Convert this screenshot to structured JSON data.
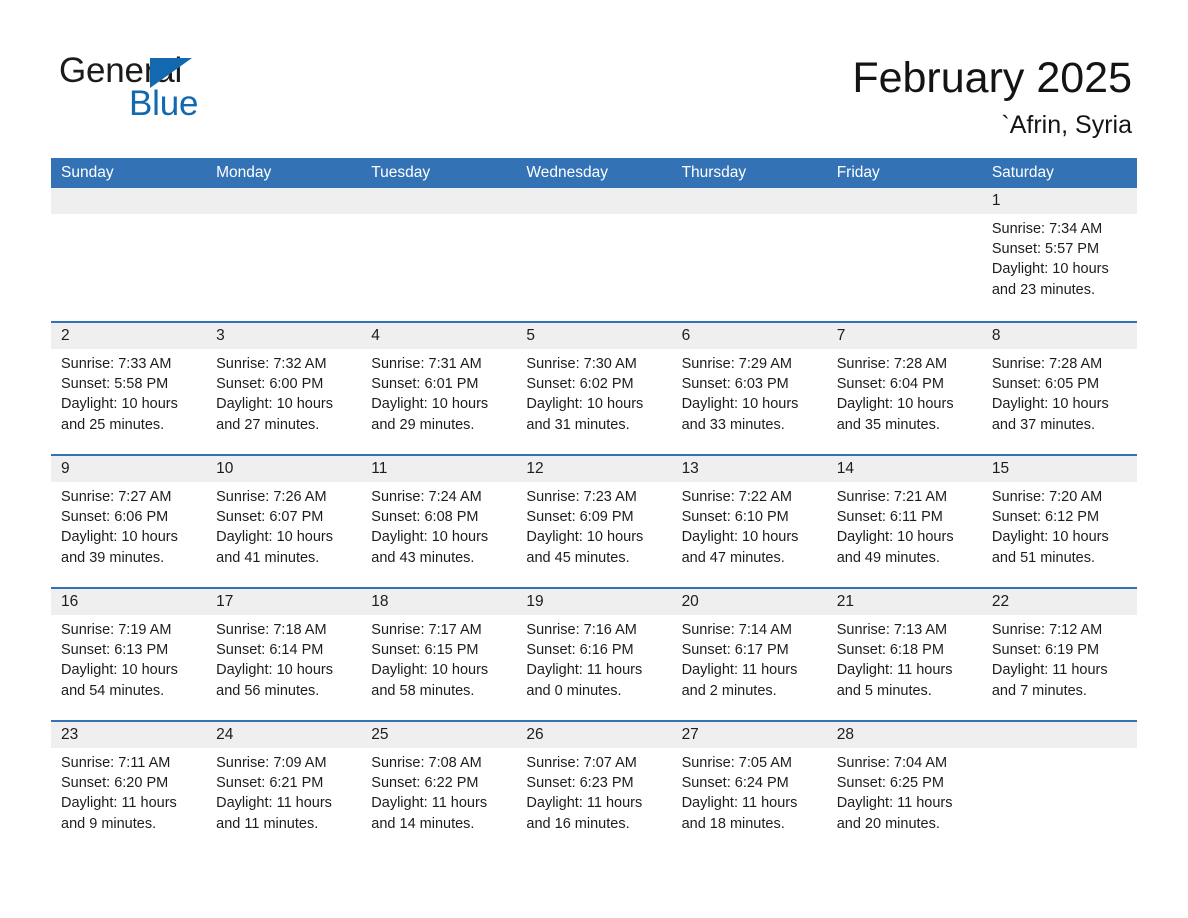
{
  "brand": {
    "name_part1": "General",
    "name_part2": "Blue",
    "triangle_color": "#1269b0",
    "text_color": "#1b1b1b"
  },
  "header": {
    "title": "February 2025",
    "location": "`Afrin, Syria"
  },
  "theme": {
    "header_blue": "#3373b5",
    "row_divider_blue": "#3373b5",
    "date_band_gray": "#efefef",
    "text_color": "#1d1d1d",
    "background": "#ffffff"
  },
  "labels": {
    "sunrise_prefix": "Sunrise:",
    "sunset_prefix": "Sunset:",
    "daylight_prefix": "Daylight:"
  },
  "weekdays": [
    "Sunday",
    "Monday",
    "Tuesday",
    "Wednesday",
    "Thursday",
    "Friday",
    "Saturday"
  ],
  "weeks": [
    [
      {
        "day": "",
        "sunrise": "",
        "sunset": "",
        "daylight": "",
        "empty": true
      },
      {
        "day": "",
        "sunrise": "",
        "sunset": "",
        "daylight": "",
        "empty": true
      },
      {
        "day": "",
        "sunrise": "",
        "sunset": "",
        "daylight": "",
        "empty": true
      },
      {
        "day": "",
        "sunrise": "",
        "sunset": "",
        "daylight": "",
        "empty": true
      },
      {
        "day": "",
        "sunrise": "",
        "sunset": "",
        "daylight": "",
        "empty": true
      },
      {
        "day": "",
        "sunrise": "",
        "sunset": "",
        "daylight": "",
        "empty": true
      },
      {
        "day": "1",
        "sunrise": "Sunrise: 7:34 AM",
        "sunset": "Sunset: 5:57 PM",
        "daylight": "Daylight: 10 hours and 23 minutes.",
        "empty": false
      }
    ],
    [
      {
        "day": "2",
        "sunrise": "Sunrise: 7:33 AM",
        "sunset": "Sunset: 5:58 PM",
        "daylight": "Daylight: 10 hours and 25 minutes.",
        "empty": false
      },
      {
        "day": "3",
        "sunrise": "Sunrise: 7:32 AM",
        "sunset": "Sunset: 6:00 PM",
        "daylight": "Daylight: 10 hours and 27 minutes.",
        "empty": false
      },
      {
        "day": "4",
        "sunrise": "Sunrise: 7:31 AM",
        "sunset": "Sunset: 6:01 PM",
        "daylight": "Daylight: 10 hours and 29 minutes.",
        "empty": false
      },
      {
        "day": "5",
        "sunrise": "Sunrise: 7:30 AM",
        "sunset": "Sunset: 6:02 PM",
        "daylight": "Daylight: 10 hours and 31 minutes.",
        "empty": false
      },
      {
        "day": "6",
        "sunrise": "Sunrise: 7:29 AM",
        "sunset": "Sunset: 6:03 PM",
        "daylight": "Daylight: 10 hours and 33 minutes.",
        "empty": false
      },
      {
        "day": "7",
        "sunrise": "Sunrise: 7:28 AM",
        "sunset": "Sunset: 6:04 PM",
        "daylight": "Daylight: 10 hours and 35 minutes.",
        "empty": false
      },
      {
        "day": "8",
        "sunrise": "Sunrise: 7:28 AM",
        "sunset": "Sunset: 6:05 PM",
        "daylight": "Daylight: 10 hours and 37 minutes.",
        "empty": false
      }
    ],
    [
      {
        "day": "9",
        "sunrise": "Sunrise: 7:27 AM",
        "sunset": "Sunset: 6:06 PM",
        "daylight": "Daylight: 10 hours and 39 minutes.",
        "empty": false
      },
      {
        "day": "10",
        "sunrise": "Sunrise: 7:26 AM",
        "sunset": "Sunset: 6:07 PM",
        "daylight": "Daylight: 10 hours and 41 minutes.",
        "empty": false
      },
      {
        "day": "11",
        "sunrise": "Sunrise: 7:24 AM",
        "sunset": "Sunset: 6:08 PM",
        "daylight": "Daylight: 10 hours and 43 minutes.",
        "empty": false
      },
      {
        "day": "12",
        "sunrise": "Sunrise: 7:23 AM",
        "sunset": "Sunset: 6:09 PM",
        "daylight": "Daylight: 10 hours and 45 minutes.",
        "empty": false
      },
      {
        "day": "13",
        "sunrise": "Sunrise: 7:22 AM",
        "sunset": "Sunset: 6:10 PM",
        "daylight": "Daylight: 10 hours and 47 minutes.",
        "empty": false
      },
      {
        "day": "14",
        "sunrise": "Sunrise: 7:21 AM",
        "sunset": "Sunset: 6:11 PM",
        "daylight": "Daylight: 10 hours and 49 minutes.",
        "empty": false
      },
      {
        "day": "15",
        "sunrise": "Sunrise: 7:20 AM",
        "sunset": "Sunset: 6:12 PM",
        "daylight": "Daylight: 10 hours and 51 minutes.",
        "empty": false
      }
    ],
    [
      {
        "day": "16",
        "sunrise": "Sunrise: 7:19 AM",
        "sunset": "Sunset: 6:13 PM",
        "daylight": "Daylight: 10 hours and 54 minutes.",
        "empty": false
      },
      {
        "day": "17",
        "sunrise": "Sunrise: 7:18 AM",
        "sunset": "Sunset: 6:14 PM",
        "daylight": "Daylight: 10 hours and 56 minutes.",
        "empty": false
      },
      {
        "day": "18",
        "sunrise": "Sunrise: 7:17 AM",
        "sunset": "Sunset: 6:15 PM",
        "daylight": "Daylight: 10 hours and 58 minutes.",
        "empty": false
      },
      {
        "day": "19",
        "sunrise": "Sunrise: 7:16 AM",
        "sunset": "Sunset: 6:16 PM",
        "daylight": "Daylight: 11 hours and 0 minutes.",
        "empty": false
      },
      {
        "day": "20",
        "sunrise": "Sunrise: 7:14 AM",
        "sunset": "Sunset: 6:17 PM",
        "daylight": "Daylight: 11 hours and 2 minutes.",
        "empty": false
      },
      {
        "day": "21",
        "sunrise": "Sunrise: 7:13 AM",
        "sunset": "Sunset: 6:18 PM",
        "daylight": "Daylight: 11 hours and 5 minutes.",
        "empty": false
      },
      {
        "day": "22",
        "sunrise": "Sunrise: 7:12 AM",
        "sunset": "Sunset: 6:19 PM",
        "daylight": "Daylight: 11 hours and 7 minutes.",
        "empty": false
      }
    ],
    [
      {
        "day": "23",
        "sunrise": "Sunrise: 7:11 AM",
        "sunset": "Sunset: 6:20 PM",
        "daylight": "Daylight: 11 hours and 9 minutes.",
        "empty": false
      },
      {
        "day": "24",
        "sunrise": "Sunrise: 7:09 AM",
        "sunset": "Sunset: 6:21 PM",
        "daylight": "Daylight: 11 hours and 11 minutes.",
        "empty": false
      },
      {
        "day": "25",
        "sunrise": "Sunrise: 7:08 AM",
        "sunset": "Sunset: 6:22 PM",
        "daylight": "Daylight: 11 hours and 14 minutes.",
        "empty": false
      },
      {
        "day": "26",
        "sunrise": "Sunrise: 7:07 AM",
        "sunset": "Sunset: 6:23 PM",
        "daylight": "Daylight: 11 hours and 16 minutes.",
        "empty": false
      },
      {
        "day": "27",
        "sunrise": "Sunrise: 7:05 AM",
        "sunset": "Sunset: 6:24 PM",
        "daylight": "Daylight: 11 hours and 18 minutes.",
        "empty": false
      },
      {
        "day": "28",
        "sunrise": "Sunrise: 7:04 AM",
        "sunset": "Sunset: 6:25 PM",
        "daylight": "Daylight: 11 hours and 20 minutes.",
        "empty": false
      },
      {
        "day": "",
        "sunrise": "",
        "sunset": "",
        "daylight": "",
        "empty": true
      }
    ]
  ]
}
